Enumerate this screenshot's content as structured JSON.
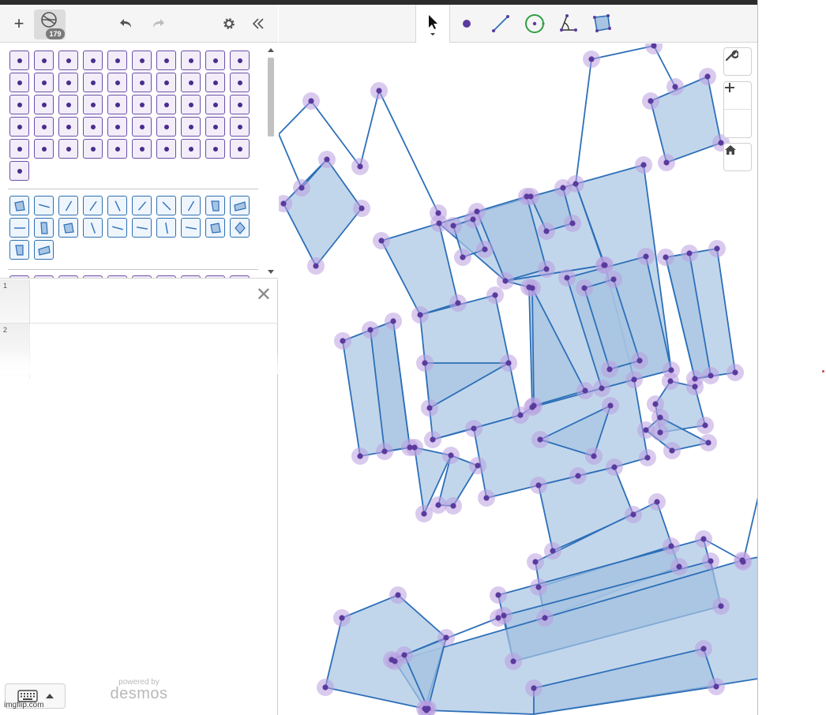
{
  "header": {
    "add_label": "+",
    "object_count": "179"
  },
  "toolbar": {
    "tools": [
      "move-tool",
      "point-tool",
      "segment-tool",
      "circle-tool",
      "angle-tool",
      "polygon-tool"
    ]
  },
  "palette": {
    "point_icon_count": 51,
    "shape_icons": [
      "polygon",
      "segment",
      "segment",
      "segment",
      "segment",
      "segment",
      "segment",
      "segment",
      "polygon",
      "polygon",
      "segment",
      "polygon",
      "polygon",
      "segment",
      "segment",
      "segment",
      "segment",
      "segment",
      "polygon",
      "polygon",
      "polygon",
      "polygon"
    ]
  },
  "expressions": [
    {
      "number": "1",
      "value": ""
    },
    {
      "number": "2",
      "value": ""
    }
  ],
  "footer": {
    "powered_by": "powered by",
    "brand": "desmos",
    "watermark": "imgflip.com"
  },
  "colors": {
    "shape_fill": "#a8c4e3",
    "shape_stroke": "#2d6fb8",
    "point": "#5b3a9e",
    "point_halo": "#b99ee0"
  }
}
